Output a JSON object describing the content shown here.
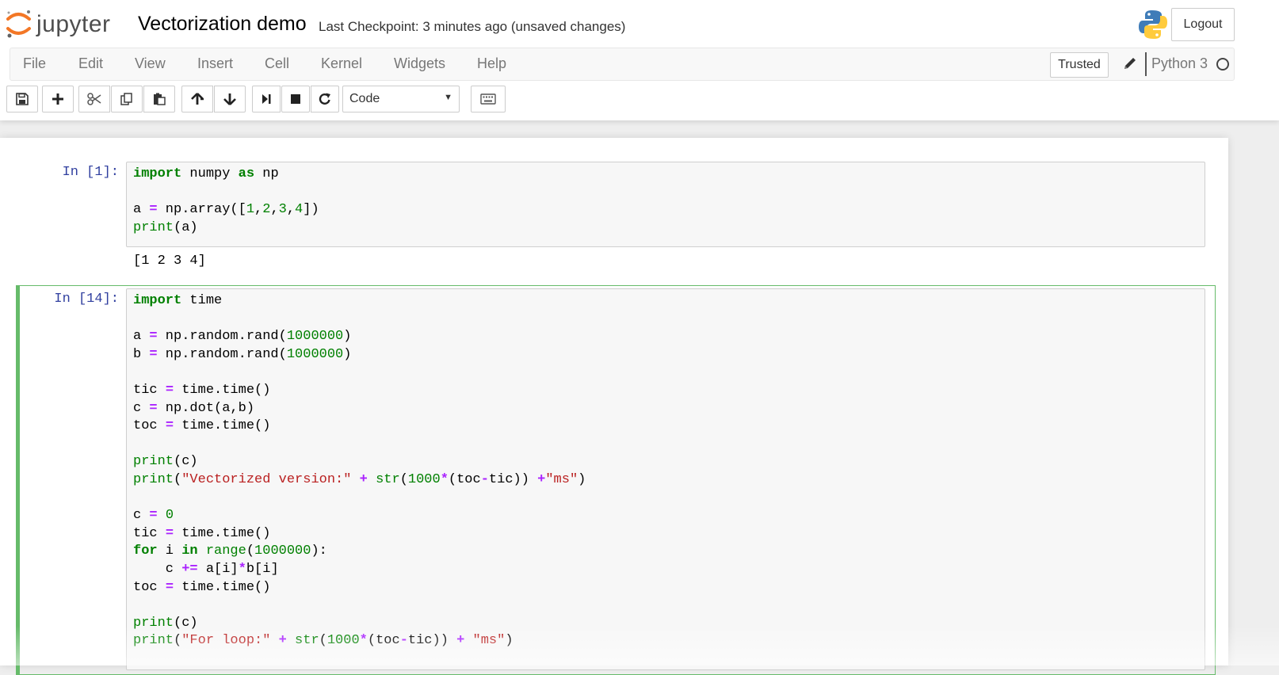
{
  "app": {
    "logo_text": "jupyter",
    "notebook_title": "Vectorization demo",
    "checkpoint_status": "Last Checkpoint: 3 minutes ago (unsaved changes)",
    "logout_label": "Logout"
  },
  "menubar": {
    "items": [
      "File",
      "Edit",
      "View",
      "Insert",
      "Cell",
      "Kernel",
      "Widgets",
      "Help"
    ],
    "trusted_label": "Trusted",
    "kernel_name": "Python 3"
  },
  "toolbar": {
    "buttons": [
      "save-icon",
      "plus-icon",
      "scissors-icon",
      "copy-icon",
      "paste-icon",
      "arrow-up-icon",
      "arrow-down-icon",
      "step-forward-icon",
      "stop-icon",
      "restart-icon",
      "keyboard-icon"
    ],
    "cell_type": "Code"
  },
  "cells": [
    {
      "prompt": "In [1]:",
      "code_lines": [
        "import numpy as np",
        "",
        "a = np.array([1,2,3,4])",
        "print(a)"
      ],
      "output": "[1 2 3 4]"
    },
    {
      "prompt": "In [14]:",
      "code_lines": [
        "import time",
        "",
        "a = np.random.rand(1000000)",
        "b = np.random.rand(1000000)",
        "",
        "tic = time.time()",
        "c = np.dot(a,b)",
        "toc = time.time()",
        "",
        "print(c)",
        "print(\"Vectorized version:\" + str(1000*(toc-tic)) +\"ms\")",
        "",
        "c = 0",
        "tic = time.time()",
        "for i in range(1000000):",
        "    c += a[i]*b[i]",
        "toc = time.time()",
        "",
        "print(c)",
        "print(\"For loop:\" + str(1000*(toc-tic)) + \"ms\")"
      ]
    }
  ],
  "colors": {
    "prompt": "#303f9f",
    "keyword": "#008000",
    "string": "#ba2121",
    "operator": "#aa22ff",
    "selected_cell_border": "#66bb6a"
  }
}
